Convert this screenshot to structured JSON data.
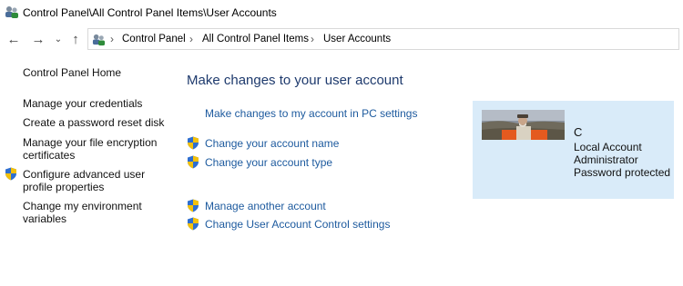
{
  "window": {
    "title": "Control Panel\\All Control Panel Items\\User Accounts"
  },
  "nav": {
    "back_icon": "arrow-left",
    "forward_icon": "arrow-right",
    "recent_icon": "chevron-down",
    "up_icon": "arrow-up",
    "breadcrumb": [
      "Control Panel",
      "All Control Panel Items",
      "User Accounts"
    ]
  },
  "sidebar": {
    "items": [
      {
        "label": "Control Panel Home",
        "shield": false
      },
      {
        "label": "Manage your credentials",
        "shield": false
      },
      {
        "label": "Create a password reset disk",
        "shield": false
      },
      {
        "label": "Manage your file encryption certificates",
        "shield": false
      },
      {
        "label": "Configure advanced user profile properties",
        "shield": true
      },
      {
        "label": "Change my environment variables",
        "shield": false
      }
    ]
  },
  "main": {
    "heading": "Make changes to your user account",
    "links": [
      {
        "label": "Make changes to my account in PC settings",
        "shield": false
      },
      {
        "label": "Change your account name",
        "shield": true
      },
      {
        "label": "Change your account type",
        "shield": true
      },
      {
        "label": "Manage another account",
        "shield": true
      },
      {
        "label": "Change User Account Control settings",
        "shield": true
      }
    ]
  },
  "account": {
    "name": "C",
    "type": "Local Account",
    "role": "Administrator",
    "password_status": "Password protected"
  },
  "colors": {
    "link": "#1d5a9e",
    "heading": "#1e3a6d",
    "panel_bg": "#d9ebf9",
    "shield_blue": "#2f6fd0",
    "shield_yellow": "#f3c10b"
  }
}
